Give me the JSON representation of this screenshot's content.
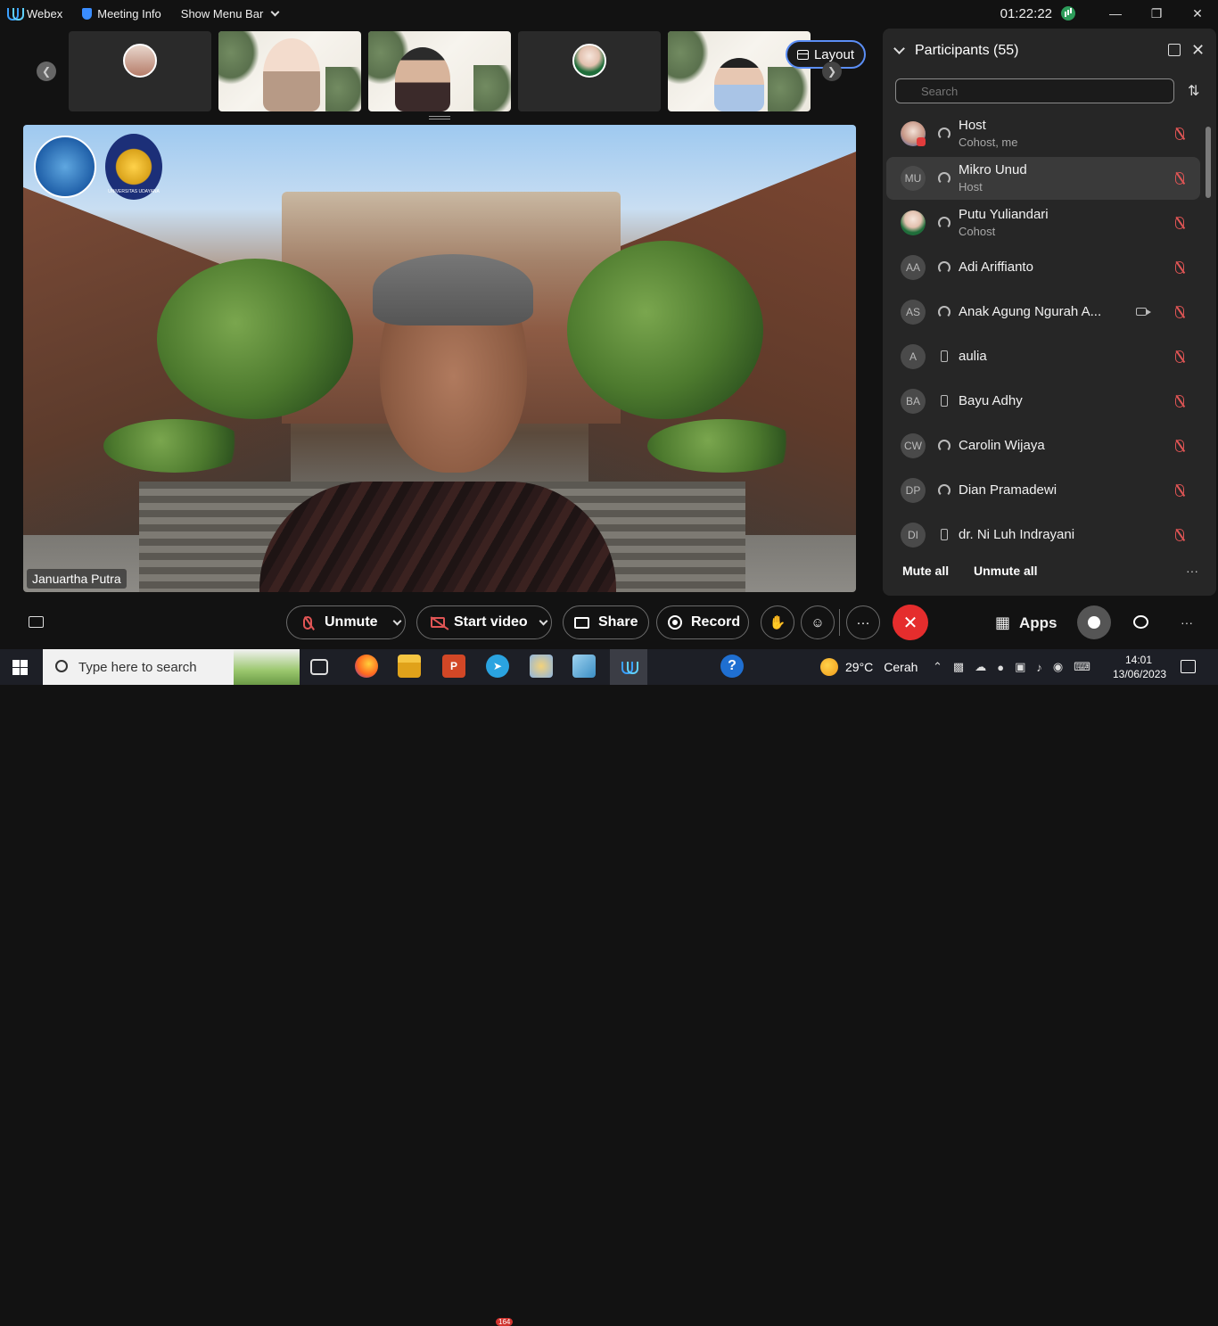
{
  "topbar": {
    "app_name": "Webex",
    "meeting_info": "Meeting Info",
    "show_menu_bar": "Show Menu Bar",
    "timer": "01:22:22"
  },
  "strip": {
    "layout_label": "Layout"
  },
  "main_video": {
    "speaker_name": "Januartha Putra",
    "logo_text": "UNIVERSITAS UDAYANA"
  },
  "participants": {
    "title": "Participants (55)",
    "search_placeholder": "Search",
    "mute_all": "Mute all",
    "unmute_all": "Unmute all",
    "list": [
      {
        "initials": "",
        "name": "Host",
        "sub": "Cohost, me",
        "conn": "computer"
      },
      {
        "initials": "MU",
        "name": "Mikro Unud",
        "sub": "Host",
        "conn": "computer"
      },
      {
        "initials": "",
        "name": "Putu Yuliandari",
        "sub": "Cohost",
        "conn": "computer"
      },
      {
        "initials": "AA",
        "name": "Adi Ariffianto",
        "sub": "",
        "conn": "computer"
      },
      {
        "initials": "AS",
        "name": "Anak Agung Ngurah A...",
        "sub": "",
        "conn": "computer"
      },
      {
        "initials": "A",
        "name": "aulia",
        "sub": "",
        "conn": "phone"
      },
      {
        "initials": "BA",
        "name": "Bayu Adhy",
        "sub": "",
        "conn": "phone"
      },
      {
        "initials": "CW",
        "name": "Carolin Wijaya",
        "sub": "",
        "conn": "computer"
      },
      {
        "initials": "DP",
        "name": "Dian Pramadewi",
        "sub": "",
        "conn": "computer"
      },
      {
        "initials": "DI",
        "name": "dr. Ni Luh Indrayani",
        "sub": "",
        "conn": "phone"
      }
    ]
  },
  "controls": {
    "unmute": "Unmute",
    "start_video": "Start video",
    "share": "Share",
    "record": "Record",
    "more": "···",
    "apps": "Apps",
    "end_color": "#e52d2d"
  },
  "taskbar": {
    "search_placeholder": "Type here to search",
    "telegram_badge": "164",
    "weather_temp": "29°C",
    "weather_text": "Cerah",
    "time": "14:01",
    "date": "13/06/2023",
    "ppt_letter": "P"
  }
}
